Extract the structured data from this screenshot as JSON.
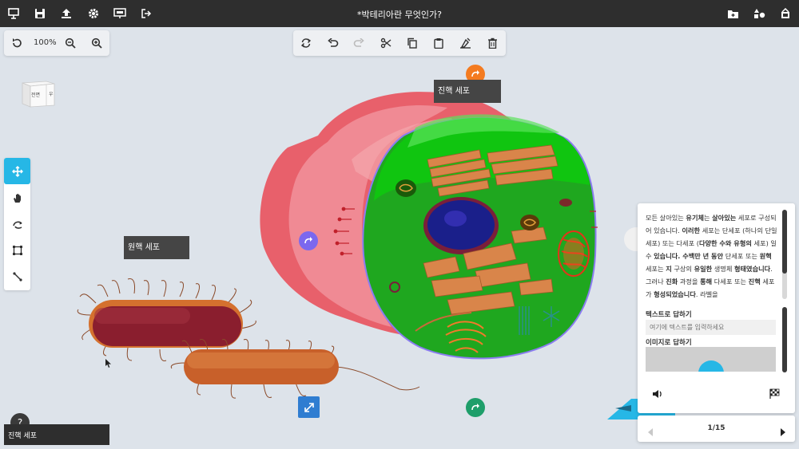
{
  "topbar": {
    "title": "*박테리아란 무엇인가?",
    "left_icons": [
      "presentation-icon",
      "save-icon",
      "upload-icon",
      "settings-icon",
      "slideshow-icon",
      "exit-icon"
    ],
    "right_icons": [
      "add-folder-icon",
      "shapes-icon",
      "library-icon"
    ]
  },
  "view_controls": {
    "zoom": "100%"
  },
  "edit_toolbar": [
    "refresh-icon",
    "undo-icon",
    "redo-icon",
    "cut-icon",
    "copy-icon",
    "paste-icon",
    "clear-format-icon",
    "delete-icon"
  ],
  "view_cube": {
    "front": "전면",
    "side": "우"
  },
  "labels": {
    "eukaryote": "진핵 세포",
    "prokaryote": "원핵 세포",
    "bottom_left": "진핵 세포"
  },
  "side_panel": {
    "description_parts": [
      {
        "t": "모든 살아있는 ",
        "b": false
      },
      {
        "t": "유기체",
        "b": true
      },
      {
        "t": "는 ",
        "b": false
      },
      {
        "t": "살아있는",
        "b": true
      },
      {
        "t": " 세포로 구성되어 있습니다. ",
        "b": false
      },
      {
        "t": "이러한",
        "b": true
      },
      {
        "t": " 세포는 단세포 (하나의 단일 세포) 또는 다세포 (",
        "b": false
      },
      {
        "t": "다양한 수와 유형의",
        "b": true
      },
      {
        "t": " 세포) 일 수 ",
        "b": false
      },
      {
        "t": "있습니다. 수백만 년 동안",
        "b": true
      },
      {
        "t": " 단세포 또는 ",
        "b": false
      },
      {
        "t": "원핵",
        "b": true
      },
      {
        "t": " 세포는 ",
        "b": false
      },
      {
        "t": "지",
        "b": true
      },
      {
        "t": " 구상의 ",
        "b": false
      },
      {
        "t": "유일한",
        "b": true
      },
      {
        "t": " 생명체 ",
        "b": false
      },
      {
        "t": "형태였습니다",
        "b": true
      },
      {
        "t": ". 그러나 ",
        "b": false
      },
      {
        "t": "진화",
        "b": true
      },
      {
        "t": " 과정을 ",
        "b": false
      },
      {
        "t": "통해",
        "b": true
      },
      {
        "t": " 다세포 또는 ",
        "b": false
      },
      {
        "t": "진핵",
        "b": true
      },
      {
        "t": " 세포가 ",
        "b": false
      },
      {
        "t": "형성되었습니다",
        "b": true
      },
      {
        "t": ". 라벨을",
        "b": false
      }
    ],
    "text_answer_label": "텍스트로 답하기",
    "text_answer_placeholder": "여기에 텍스트를 입력하세요",
    "image_answer_label": "이미지로 답하기"
  },
  "pager": {
    "page": "1/15"
  },
  "help": "?",
  "colors": {
    "accent": "#26b7e6",
    "green_btn": "#1e9e6a",
    "orange_btn": "#f47b20",
    "purple_btn": "#7b68ee",
    "blue_btn": "#2f7dd1"
  }
}
